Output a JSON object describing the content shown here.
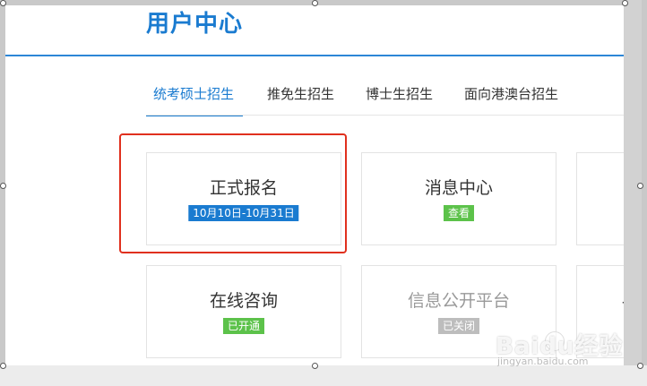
{
  "header": {
    "title": "用户中心"
  },
  "tabs": [
    {
      "label": "统考硕士招生",
      "active": true
    },
    {
      "label": "推免生招生",
      "active": false
    },
    {
      "label": "博士生招生",
      "active": false
    },
    {
      "label": "面向港澳台招生",
      "active": false
    }
  ],
  "cards": [
    {
      "title": "正式报名",
      "badge": "10月10日-10月31日",
      "badge_color": "#1a7bd0",
      "selected": true
    },
    {
      "title": "消息中心",
      "badge": "查看",
      "badge_color": "#5cc24a"
    },
    {
      "title": "在线咨询",
      "badge": "已开通",
      "badge_color": "#5cc24a"
    },
    {
      "title": "信息公开平台",
      "badge": "已关闭",
      "badge_color": "#bdbdbd",
      "muted": true
    }
  ],
  "partial_glyph": "讠",
  "watermark": {
    "text": "Baidu经验",
    "sub": "jingyan.baidu.com"
  },
  "colors": {
    "accent": "#1a7bd0",
    "selection": "#e0301e"
  }
}
